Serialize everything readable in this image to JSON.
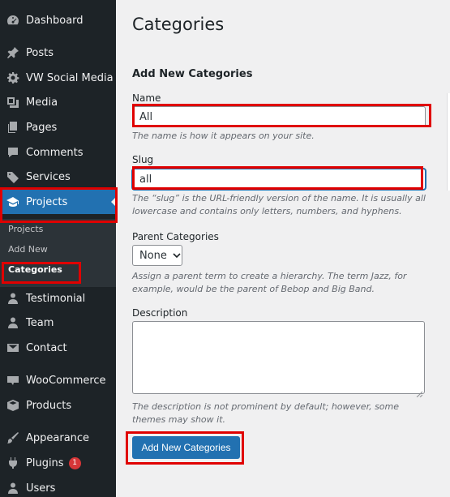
{
  "sidebar": {
    "items": [
      {
        "label": "Dashboard",
        "icon": "dashboard-icon"
      },
      {
        "label": "Posts",
        "icon": "pin-icon"
      },
      {
        "label": "VW Social Media",
        "icon": "gear-icon"
      },
      {
        "label": "Media",
        "icon": "media-icon"
      },
      {
        "label": "Pages",
        "icon": "pages-icon"
      },
      {
        "label": "Comments",
        "icon": "comment-icon"
      },
      {
        "label": "Services",
        "icon": "tag-icon"
      },
      {
        "label": "Projects",
        "icon": "graduation-cap-icon",
        "active": true
      },
      {
        "label": "Testimonial",
        "icon": "person-icon"
      },
      {
        "label": "Team",
        "icon": "person-icon"
      },
      {
        "label": "Contact",
        "icon": "envelope-icon"
      },
      {
        "label": "WooCommerce",
        "icon": "woo-icon"
      },
      {
        "label": "Products",
        "icon": "box-icon"
      },
      {
        "label": "Appearance",
        "icon": "brush-icon"
      },
      {
        "label": "Plugins",
        "icon": "plug-icon",
        "badge": "1"
      },
      {
        "label": "Users",
        "icon": "person-icon"
      }
    ],
    "submenu": [
      {
        "label": "Projects"
      },
      {
        "label": "Add New"
      },
      {
        "label": "Categories",
        "current": true
      }
    ]
  },
  "main": {
    "page_title": "Categories",
    "form_title": "Add New Categories",
    "name": {
      "label": "Name",
      "value": "All",
      "help": "The name is how it appears on your site."
    },
    "slug": {
      "label": "Slug",
      "value": "all",
      "help": "The “slug” is the URL-friendly version of the name. It is usually all lowercase and contains only letters, numbers, and hyphens."
    },
    "parent": {
      "label": "Parent Categories",
      "selected": "None",
      "help": "Assign a parent term to create a hierarchy. The term Jazz, for example, would be the parent of Bebop and Big Band."
    },
    "description": {
      "label": "Description",
      "value": "",
      "help": "The description is not prominent by default; however, some themes may show it."
    },
    "submit_label": "Add New Categories"
  },
  "colors": {
    "sidebar_bg": "#1d2327",
    "submenu_bg": "#2c3338",
    "accent": "#2271b1",
    "highlight": "#e00000",
    "badge": "#d63638"
  }
}
